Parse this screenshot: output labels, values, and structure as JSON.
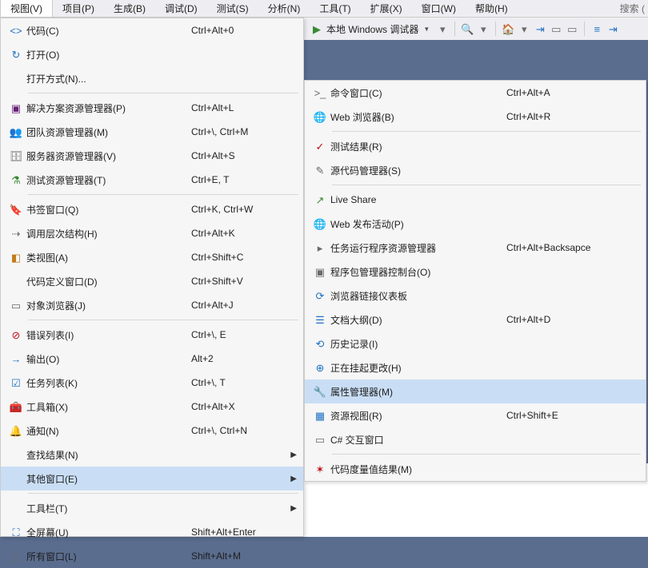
{
  "menubar": {
    "items": [
      {
        "label": "视图(V)"
      },
      {
        "label": "项目(P)"
      },
      {
        "label": "生成(B)"
      },
      {
        "label": "调试(D)"
      },
      {
        "label": "测试(S)"
      },
      {
        "label": "分析(N)"
      },
      {
        "label": "工具(T)"
      },
      {
        "label": "扩展(X)"
      },
      {
        "label": "窗口(W)"
      },
      {
        "label": "帮助(H)"
      }
    ],
    "search_placeholder": "搜索 ("
  },
  "toolbar": {
    "debugger_label": "本地 Windows 调试器"
  },
  "view_menu": {
    "group1": [
      {
        "label": "代码(C)",
        "shortcut": "Ctrl+Alt+0",
        "icon": "code-icon",
        "cls": "blue",
        "glyph": "<>"
      },
      {
        "label": "打开(O)",
        "shortcut": "",
        "icon": "open-icon",
        "cls": "blue",
        "glyph": "↻"
      },
      {
        "label": "打开方式(N)...",
        "shortcut": "",
        "icon": "",
        "cls": "",
        "glyph": ""
      }
    ],
    "group2": [
      {
        "label": "解决方案资源管理器(P)",
        "shortcut": "Ctrl+Alt+L",
        "icon": "solution-explorer-icon",
        "cls": "purple",
        "glyph": "▣"
      },
      {
        "label": "团队资源管理器(M)",
        "shortcut": "Ctrl+\\, Ctrl+M",
        "icon": "team-explorer-icon",
        "cls": "gray",
        "glyph": "👥"
      },
      {
        "label": "服务器资源管理器(V)",
        "shortcut": "Ctrl+Alt+S",
        "icon": "server-explorer-icon",
        "cls": "gray",
        "glyph": "🗄"
      },
      {
        "label": "测试资源管理器(T)",
        "shortcut": "Ctrl+E, T",
        "icon": "test-explorer-icon",
        "cls": "green",
        "glyph": "⚗"
      }
    ],
    "group3": [
      {
        "label": "书签窗口(Q)",
        "shortcut": "Ctrl+K, Ctrl+W",
        "icon": "bookmark-window-icon",
        "cls": "blue",
        "glyph": "🔖"
      },
      {
        "label": "调用层次结构(H)",
        "shortcut": "Ctrl+Alt+K",
        "icon": "call-hierarchy-icon",
        "cls": "gray",
        "glyph": "⇢"
      },
      {
        "label": "类视图(A)",
        "shortcut": "Ctrl+Shift+C",
        "icon": "class-view-icon",
        "cls": "orange",
        "glyph": "◧"
      },
      {
        "label": "代码定义窗口(D)",
        "shortcut": "Ctrl+Shift+V",
        "icon": "",
        "cls": "",
        "glyph": ""
      },
      {
        "label": "对象浏览器(J)",
        "shortcut": "Ctrl+Alt+J",
        "icon": "object-browser-icon",
        "cls": "gray",
        "glyph": "▭"
      }
    ],
    "group4": [
      {
        "label": "错误列表(I)",
        "shortcut": "Ctrl+\\, E",
        "icon": "error-list-icon",
        "cls": "red",
        "glyph": "⊘"
      },
      {
        "label": "输出(O)",
        "shortcut": "Alt+2",
        "icon": "output-icon",
        "cls": "blue",
        "glyph": "→"
      },
      {
        "label": "任务列表(K)",
        "shortcut": "Ctrl+\\, T",
        "icon": "task-list-icon",
        "cls": "blue",
        "glyph": "☑"
      },
      {
        "label": "工具箱(X)",
        "shortcut": "Ctrl+Alt+X",
        "icon": "toolbox-icon",
        "cls": "gray",
        "glyph": "🧰"
      },
      {
        "label": "通知(N)",
        "shortcut": "Ctrl+\\, Ctrl+N",
        "icon": "notifications-icon",
        "cls": "gray",
        "glyph": "🔔"
      },
      {
        "label": "查找结果(N)",
        "shortcut": "",
        "icon": "",
        "cls": "",
        "glyph": "",
        "sub": true
      },
      {
        "label": "其他窗口(E)",
        "shortcut": "",
        "icon": "",
        "cls": "",
        "glyph": "",
        "sub": true,
        "hover": true
      }
    ],
    "group5": [
      {
        "label": "工具栏(T)",
        "shortcut": "",
        "icon": "",
        "cls": "",
        "glyph": "",
        "sub": true
      },
      {
        "label": "全屏幕(U)",
        "shortcut": "Shift+Alt+Enter",
        "icon": "fullscreen-icon",
        "cls": "blue",
        "glyph": "⛶"
      },
      {
        "label": "所有窗口(L)",
        "shortcut": "Shift+Alt+M",
        "icon": "all-windows-icon",
        "cls": "gray",
        "glyph": "▢"
      }
    ]
  },
  "other_windows_menu": {
    "group1": [
      {
        "label": "命令窗口(C)",
        "shortcut": "Ctrl+Alt+A",
        "icon": "command-window-icon",
        "cls": "gray",
        "glyph": ">_"
      },
      {
        "label": "Web 浏览器(B)",
        "shortcut": "Ctrl+Alt+R",
        "icon": "web-browser-icon",
        "cls": "blue",
        "glyph": "🌐"
      }
    ],
    "group2": [
      {
        "label": "测试结果(R)",
        "shortcut": "",
        "icon": "test-results-icon",
        "cls": "red",
        "glyph": "✓"
      },
      {
        "label": "源代码管理器(S)",
        "shortcut": "",
        "icon": "source-control-icon",
        "cls": "gray",
        "glyph": "✎"
      }
    ],
    "group3": [
      {
        "label": "Live Share",
        "shortcut": "",
        "icon": "live-share-icon",
        "cls": "green",
        "glyph": "↗"
      },
      {
        "label": "Web 发布活动(P)",
        "shortcut": "",
        "icon": "web-publish-icon",
        "cls": "blue",
        "glyph": "🌐"
      },
      {
        "label": "任务运行程序资源管理器",
        "shortcut": "Ctrl+Alt+Backsapce",
        "icon": "task-runner-icon",
        "cls": "gray",
        "glyph": "▸"
      },
      {
        "label": "程序包管理器控制台(O)",
        "shortcut": "",
        "icon": "package-manager-icon",
        "cls": "gray",
        "glyph": "▣"
      },
      {
        "label": "浏览器链接仪表板",
        "shortcut": "",
        "icon": "browser-link-icon",
        "cls": "blue",
        "glyph": "⟳"
      },
      {
        "label": "文档大纲(D)",
        "shortcut": "Ctrl+Alt+D",
        "icon": "document-outline-icon",
        "cls": "blue",
        "glyph": "☰"
      },
      {
        "label": "历史记录(I)",
        "shortcut": "",
        "icon": "history-icon",
        "cls": "blue",
        "glyph": "⟲"
      },
      {
        "label": "正在挂起更改(H)",
        "shortcut": "",
        "icon": "pending-changes-icon",
        "cls": "blue",
        "glyph": "⊕"
      },
      {
        "label": "属性管理器(M)",
        "shortcut": "",
        "icon": "property-manager-icon",
        "cls": "gray",
        "glyph": "🔧",
        "hover": true
      },
      {
        "label": "资源视图(R)",
        "shortcut": "Ctrl+Shift+E",
        "icon": "resource-view-icon",
        "cls": "blue",
        "glyph": "▦"
      },
      {
        "label": "C# 交互窗口",
        "shortcut": "",
        "icon": "csharp-interactive-icon",
        "cls": "gray",
        "glyph": "▭"
      }
    ],
    "group4": [
      {
        "label": "代码度量值结果(M)",
        "shortcut": "",
        "icon": "code-metrics-icon",
        "cls": "red",
        "glyph": "✶"
      }
    ]
  }
}
